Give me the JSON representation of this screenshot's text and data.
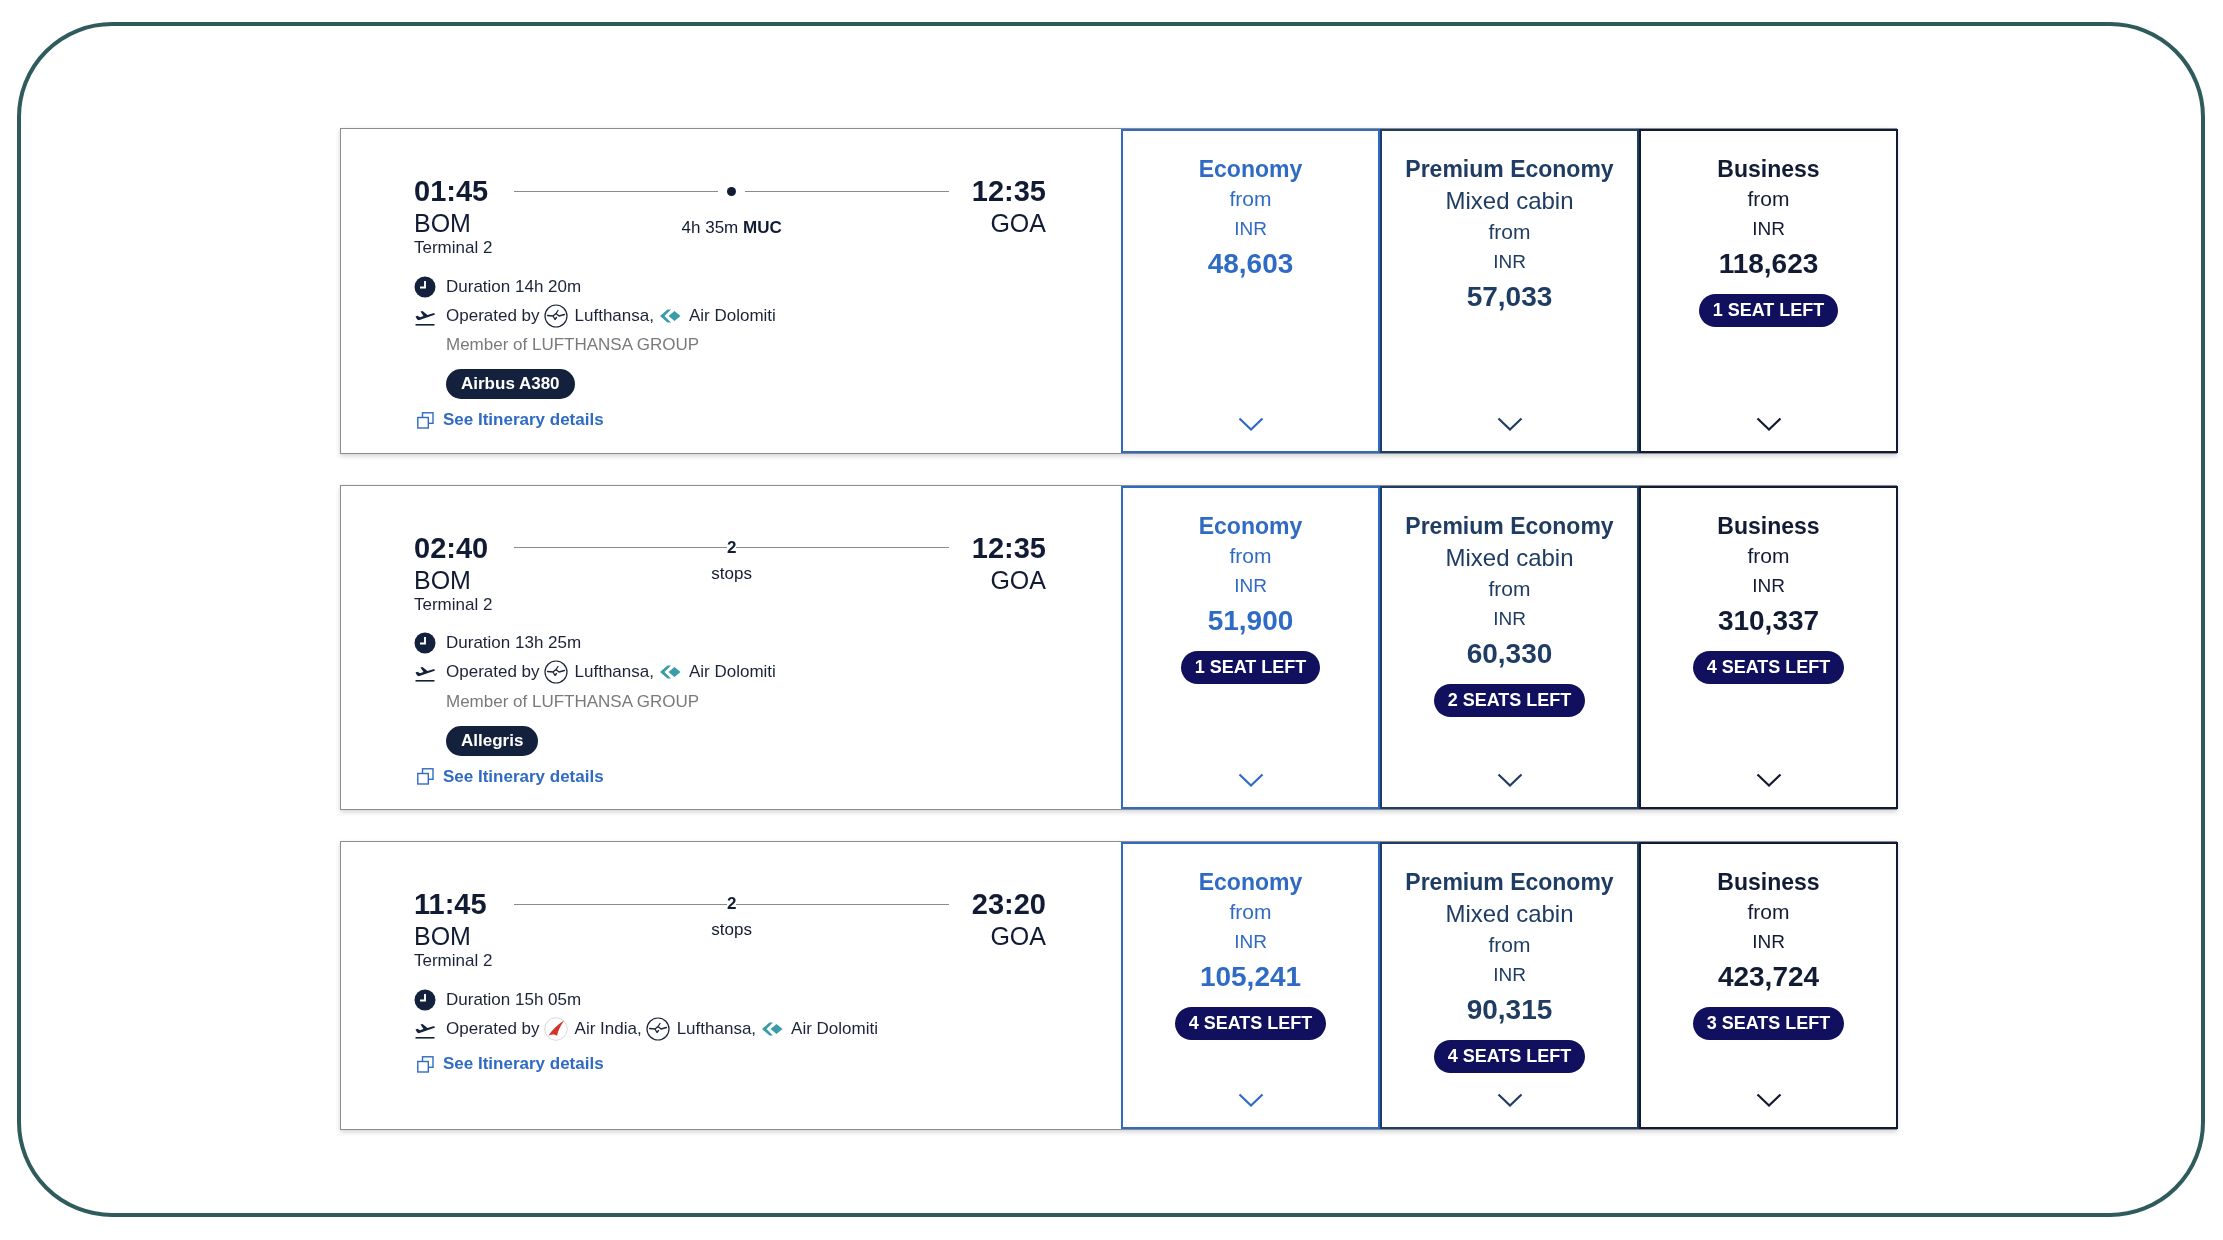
{
  "flights": [
    {
      "departure": {
        "time": "01:45",
        "airport": "BOM",
        "terminal": "Terminal 2"
      },
      "connection": {
        "kind": "layover",
        "label": "4h 35m **MUC**"
      },
      "arrival": {
        "time": "12:35",
        "airport": "GOA"
      },
      "duration": "Duration 14h 20m",
      "operated_by_label": "Operated by",
      "operators": [
        {
          "kind": "roundel",
          "name": "Lufthansa,"
        },
        {
          "kind": "arrows",
          "name": "Air Dolomiti"
        }
      ],
      "group_note": "Member of LUFTHANSA GROUP",
      "aircraft": "Airbus A380",
      "details_link": "See Itinerary details",
      "fares": [
        {
          "cabin": "Economy",
          "from_label": "from",
          "currency": "INR",
          "price": "48,603",
          "color": "#2f6bc4"
        },
        {
          "cabin": "Premium Economy",
          "note": "Mixed cabin",
          "from_label": "from",
          "currency": "INR",
          "price": "57,033",
          "color": "#1f3d63"
        },
        {
          "cabin": "Business",
          "from_label": "from",
          "currency": "INR",
          "price": "118,623",
          "seats_left": "1 SEAT LEFT",
          "color": "#111b33"
        }
      ]
    },
    {
      "departure": {
        "time": "02:40",
        "airport": "BOM",
        "terminal": "Terminal 2"
      },
      "connection": {
        "kind": "stops",
        "count": "2",
        "label": "stops"
      },
      "arrival": {
        "time": "12:35",
        "airport": "GOA"
      },
      "duration": "Duration 13h 25m",
      "operated_by_label": "Operated by",
      "operators": [
        {
          "kind": "roundel",
          "name": "Lufthansa,"
        },
        {
          "kind": "arrows",
          "name": "Air Dolomiti"
        }
      ],
      "group_note": "Member of LUFTHANSA GROUP",
      "aircraft": "Allegris",
      "details_link": "See Itinerary details",
      "fares": [
        {
          "cabin": "Economy",
          "from_label": "from",
          "currency": "INR",
          "price": "51,900",
          "seats_left": "1 SEAT LEFT",
          "color": "#2f6bc4"
        },
        {
          "cabin": "Premium Economy",
          "note": "Mixed cabin",
          "from_label": "from",
          "currency": "INR",
          "price": "60,330",
          "seats_left": "2 SEATS LEFT",
          "color": "#1f3d63"
        },
        {
          "cabin": "Business",
          "from_label": "from",
          "currency": "INR",
          "price": "310,337",
          "seats_left": "4 SEATS LEFT",
          "color": "#111b33"
        }
      ]
    },
    {
      "departure": {
        "time": "11:45",
        "airport": "BOM",
        "terminal": "Terminal 2"
      },
      "connection": {
        "kind": "stops",
        "count": "2",
        "label": "stops"
      },
      "arrival": {
        "time": "23:20",
        "airport": "GOA"
      },
      "duration": "Duration 15h 05m",
      "operated_by_label": "Operated by",
      "operators": [
        {
          "kind": "wing",
          "name": "Air India,"
        },
        {
          "kind": "roundel",
          "name": "Lufthansa,"
        },
        {
          "kind": "arrows",
          "name": "Air Dolomiti"
        }
      ],
      "details_link": "See Itinerary details",
      "fares": [
        {
          "cabin": "Economy",
          "from_label": "from",
          "currency": "INR",
          "price": "105,241",
          "seats_left": "4 SEATS LEFT",
          "color": "#2f6bc4"
        },
        {
          "cabin": "Premium Economy",
          "note": "Mixed cabin",
          "from_label": "from",
          "currency": "INR",
          "price": "90,315",
          "seats_left": "4 SEATS LEFT",
          "color": "#1f3d63"
        },
        {
          "cabin": "Business",
          "from_label": "from",
          "currency": "INR",
          "price": "423,724",
          "seats_left": "3 SEATS LEFT",
          "color": "#111b33"
        }
      ]
    }
  ]
}
